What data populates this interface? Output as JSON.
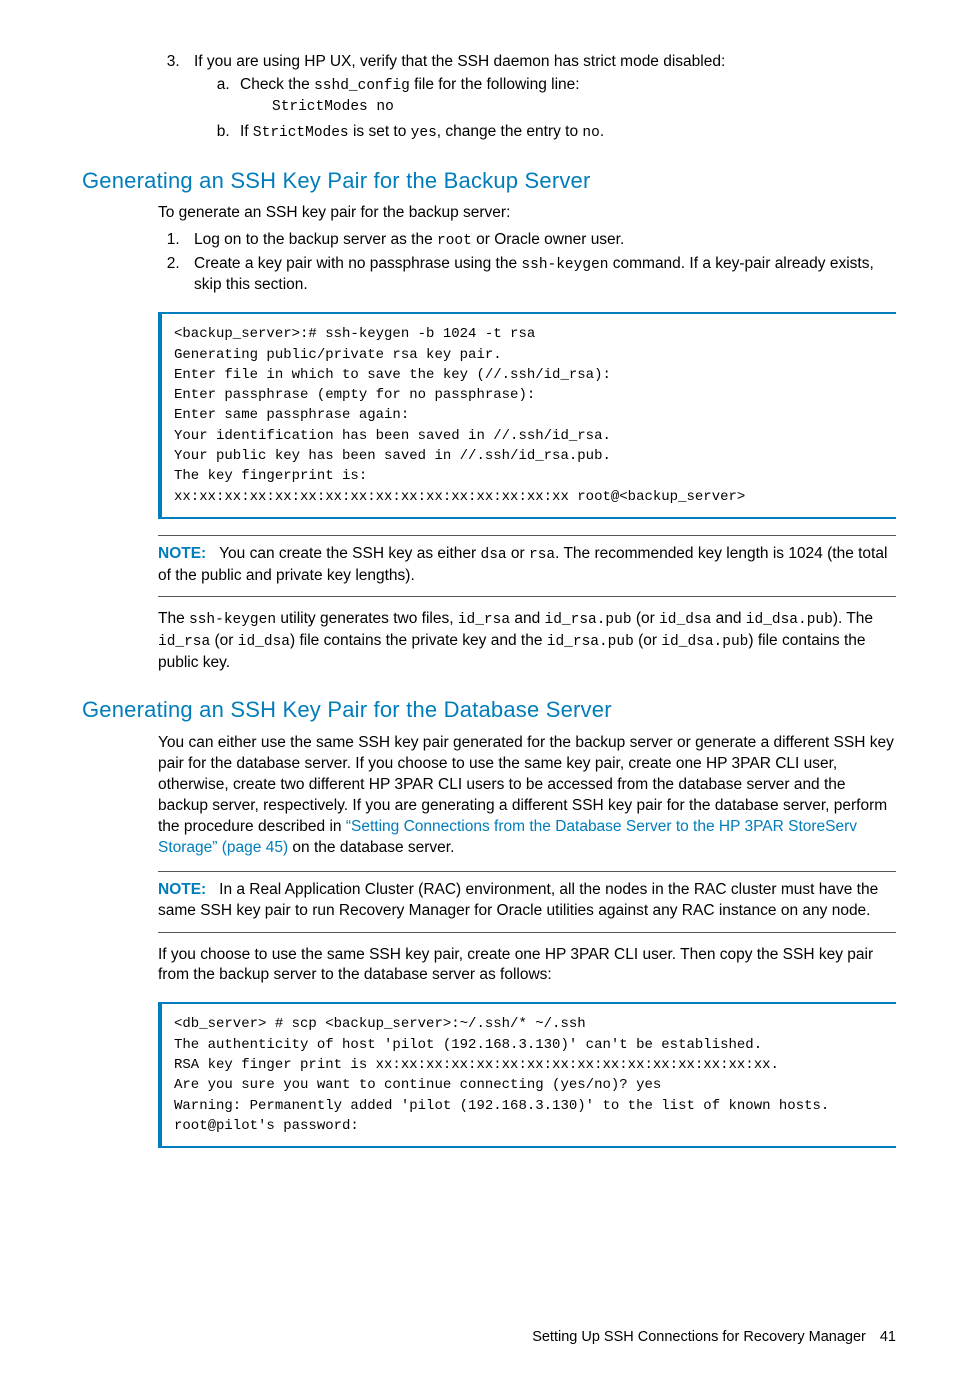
{
  "step3": {
    "text_before": "If you are using HP UX, verify that the SSH daemon has strict mode disabled:",
    "a_before": "Check the ",
    "a_code": "sshd_config",
    "a_after": " file for the following line:",
    "a_sub": "StrictModes no",
    "b_before": "If ",
    "b_code1": "StrictModes",
    "b_mid": " is set to ",
    "b_code2": "yes",
    "b_mid2": ", change the entry to ",
    "b_code3": "no",
    "b_end": "."
  },
  "s1": {
    "heading": "Generating an SSH Key Pair for the Backup Server",
    "intro": "To generate an SSH key pair for the backup server:",
    "li1_before": "Log on to the backup server as the ",
    "li1_code": "root",
    "li1_after": " or Oracle owner user.",
    "li2_before": "Create a key pair with no passphrase using the ",
    "li2_code": "ssh-keygen",
    "li2_after": " command. If a key-pair already exists, skip this section.",
    "code": "<backup_server>:# ssh-keygen -b 1024 -t rsa\nGenerating public/private rsa key pair.\nEnter file in which to save the key (//.ssh/id_rsa):\nEnter passphrase (empty for no passphrase):\nEnter same passphrase again:\nYour identification has been saved in //.ssh/id_rsa.\nYour public key has been saved in //.ssh/id_rsa.pub.\nThe key fingerprint is:\nxx:xx:xx:xx:xx:xx:xx:xx:xx:xx:xx:xx:xx:xx:xx:xx root@<backup_server>",
    "note_label": "NOTE:",
    "note_p1a": "You can create the SSH key as either ",
    "note_c1": "dsa",
    "note_p1b": " or ",
    "note_c2": "rsa",
    "note_p1c": ". The recommended key length is 1024 (the total of the public and private key lengths).",
    "p2a": "The ",
    "p2c1": "ssh-keygen",
    "p2b": " utility generates two files, ",
    "p2c2": "id_rsa",
    "p2c": " and ",
    "p2c3": "id_rsa.pub",
    "p2d": " (or ",
    "p2c4": "id_dsa",
    "p2e": " and ",
    "p2c5": "id_dsa.pub",
    "p2f": "). The ",
    "p2c6": "id_rsa",
    "p2g": " (or ",
    "p2c7": "id_dsa",
    "p2h": ") file contains the private key and the ",
    "p2c8": "id_rsa.pub",
    "p2i": " (or ",
    "p2c9": "id_dsa.pub",
    "p2j": ") file contains the public key."
  },
  "s2": {
    "heading": "Generating an SSH Key Pair for the Database Server",
    "p1a": "You can either use the same SSH key pair generated for the backup server or generate a different SSH key pair for the database server. If you choose to use the same key pair, create one HP 3PAR CLI user, otherwise, create two different HP 3PAR CLI users to be accessed from the database server and the backup server, respectively. If you are generating a different SSH key pair for the database server, perform the procedure described in ",
    "link": "“Setting Connections from the Database Server to the HP 3PAR StoreServ Storage” (page 45)",
    "p1b": " on the database server.",
    "note_label": "NOTE:",
    "note": "In a Real Application Cluster (RAC) environment, all the nodes in the RAC cluster must have the same SSH key pair to run Recovery Manager for Oracle utilities against any RAC instance on any node.",
    "p2": "If you choose to use the same SSH key pair, create one HP 3PAR CLI user. Then copy the SSH key pair from the backup server to the database server as follows:",
    "code": "<db_server> # scp <backup_server>:~/.ssh/* ~/.ssh\nThe authenticity of host 'pilot (192.168.3.130)' can't be established.\nRSA key finger print is xx:xx:xx:xx:xx:xx:xx:xx:xx:xx:xx:xx:xx:xx:xx:xx.\nAre you sure you want to continue connecting (yes/no)? yes\nWarning: Permanently added 'pilot (192.168.3.130)' to the list of known hosts.\nroot@pilot's password:"
  },
  "footer": {
    "text": "Setting Up SSH Connections for Recovery Manager",
    "page": "41"
  }
}
